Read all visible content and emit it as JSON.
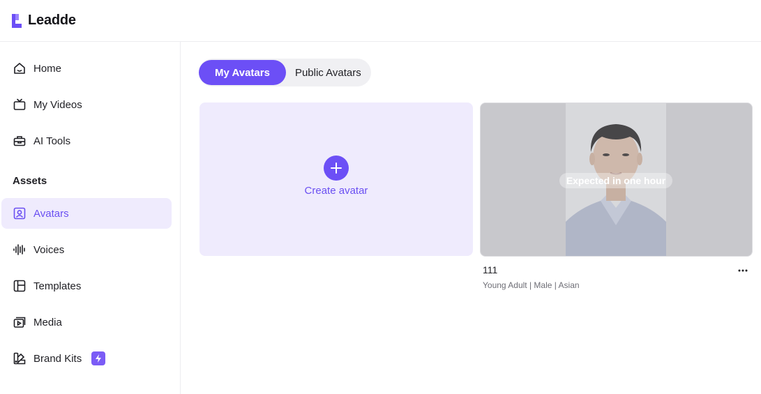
{
  "app": {
    "name": "Leadde"
  },
  "sidebar": {
    "items": [
      {
        "label": "Home",
        "icon": "home-icon"
      },
      {
        "label": "My Videos",
        "icon": "tv-icon"
      },
      {
        "label": "AI Tools",
        "icon": "toolbox-icon"
      }
    ],
    "section_label": "Assets",
    "asset_items": [
      {
        "label": "Avatars",
        "icon": "avatar-icon",
        "active": true
      },
      {
        "label": "Voices",
        "icon": "waveform-icon"
      },
      {
        "label": "Templates",
        "icon": "layout-icon"
      },
      {
        "label": "Media",
        "icon": "media-icon"
      },
      {
        "label": "Brand Kits",
        "icon": "palette-icon",
        "badge": "lightning-icon"
      }
    ]
  },
  "tabs": [
    {
      "label": "My Avatars",
      "active": true
    },
    {
      "label": "Public Avatars",
      "active": false
    }
  ],
  "create_card": {
    "label": "Create avatar"
  },
  "avatar": {
    "name": "111",
    "meta": "Young Adult | Male | Asian",
    "status": "Expected in one hour"
  },
  "colors": {
    "accent": "#6c4ff6",
    "accent_light": "#efebfd"
  }
}
